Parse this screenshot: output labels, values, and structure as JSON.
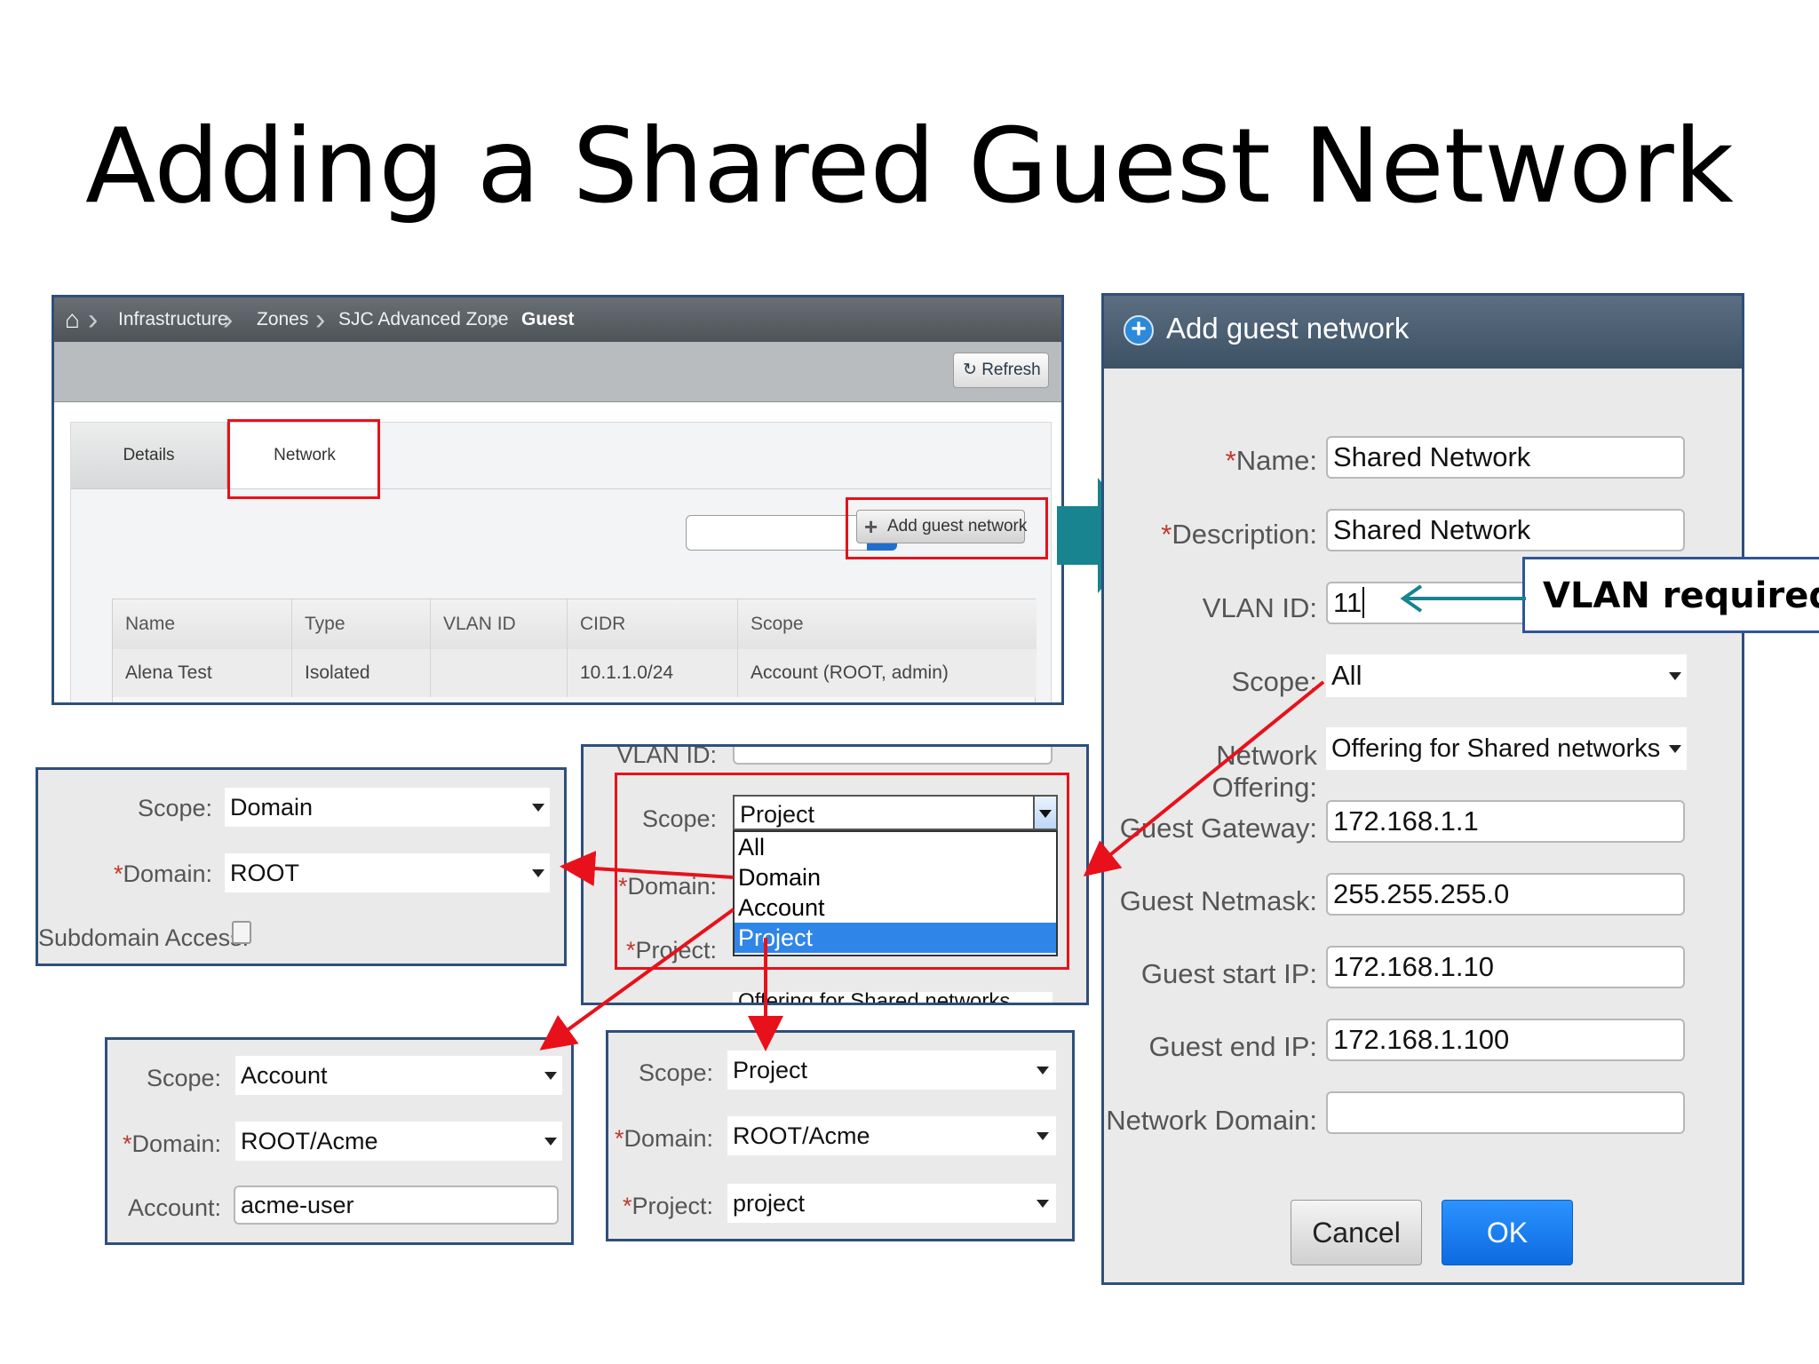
{
  "slide": {
    "title": "Adding a Shared Guest Network"
  },
  "breadcrumb": {
    "items": [
      "Infrastructure",
      "Zones",
      "SJC Advanced Zone",
      "Guest"
    ]
  },
  "toolbar": {
    "refresh_label": "Refresh"
  },
  "tabs": [
    {
      "label": "Details"
    },
    {
      "label": "Network"
    }
  ],
  "list": {
    "search_placeholder": "",
    "add_button_label": "Add guest network",
    "columns": [
      "Name",
      "Type",
      "VLAN ID",
      "CIDR",
      "Scope"
    ],
    "rows": [
      [
        "Alena Test",
        "Isolated",
        "",
        "10.1.1.0/24",
        "Account (ROOT, admin)"
      ]
    ]
  },
  "dialog": {
    "title": "Add guest network",
    "fields": [
      {
        "label": "Name:",
        "required": true,
        "value": "Shared Network"
      },
      {
        "label": "Description:",
        "required": true,
        "value": "Shared Network"
      },
      {
        "label": "VLAN ID:",
        "required": false,
        "value": "11"
      },
      {
        "label": "Scope:",
        "required": false,
        "value": "All"
      },
      {
        "label": "Network Offering:",
        "required": false,
        "value": "Offering for Shared networks"
      },
      {
        "label": "Guest Gateway:",
        "required": false,
        "value": "172.168.1.1"
      },
      {
        "label": "Guest Netmask:",
        "required": false,
        "value": "255.255.255.0"
      },
      {
        "label": "Guest start IP:",
        "required": false,
        "value": "172.168.1.10"
      },
      {
        "label": "Guest end IP:",
        "required": false,
        "value": "172.168.1.100"
      },
      {
        "label": "Network Domain:",
        "required": false,
        "value": ""
      }
    ],
    "cancel_label": "Cancel",
    "ok_label": "OK"
  },
  "callout": {
    "text": "VLAN required"
  },
  "scope_dropdown_panel": {
    "vlan_label_partial": "VLAN ID:",
    "scope_label": "Scope:",
    "scope_value": "Project",
    "domain_label": "Domain:",
    "project_label": "Project:",
    "options": [
      "All",
      "Domain",
      "Account",
      "Project"
    ],
    "selected_option": "Project",
    "offering_partial": "Offering for Shared networks"
  },
  "domain_panel": {
    "scope_label": "Scope:",
    "scope_value": "Domain",
    "domain_label": "Domain:",
    "domain_value": "ROOT",
    "subdomain_label": "Subdomain Access:"
  },
  "account_panel": {
    "scope_label": "Scope:",
    "scope_value": "Account",
    "domain_label": "Domain:",
    "domain_value": "ROOT/Acme",
    "account_label": "Account:",
    "account_value": "acme-user"
  },
  "project_panel": {
    "scope_label": "Scope:",
    "scope_value": "Project",
    "domain_label": "Domain:",
    "domain_value": "ROOT/Acme",
    "project_label": "Project:",
    "project_value": "project"
  },
  "colors": {
    "highlight_red": "#e8111b",
    "panel_border": "#2f4f7a",
    "teal_arrow": "#17848f",
    "ok_blue": "#0d6ae0",
    "selection_blue": "#2f86e8"
  }
}
